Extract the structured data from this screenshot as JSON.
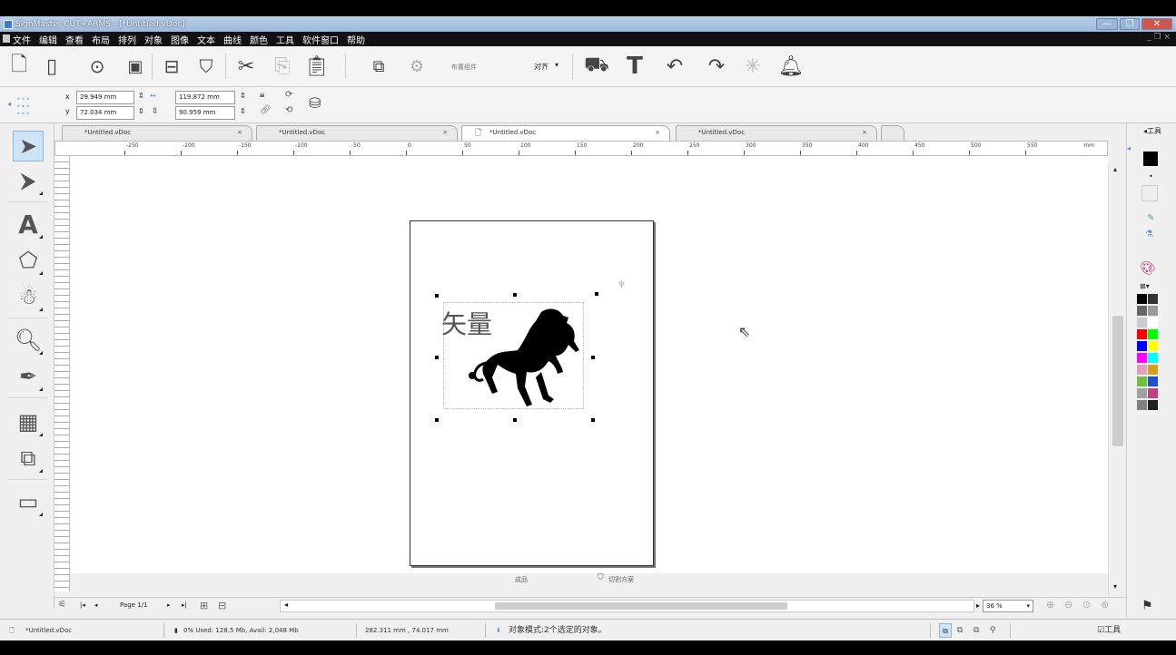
{
  "window": {
    "title": "SignMaster CUT+ARMS - [*Untitled.vDoc]",
    "controls": [
      "minimize",
      "restore",
      "close"
    ]
  },
  "menu": {
    "items": [
      "文件",
      "编辑",
      "查看",
      "布局",
      "排列",
      "对象",
      "图像",
      "文本",
      "曲线",
      "颜色",
      "工具",
      "软件窗口",
      "帮助"
    ],
    "mdi_controls": "_ ❐ ×"
  },
  "toolbar": {
    "group_label": "布置组件",
    "align_label": "对齐"
  },
  "property_bar": {
    "x_label": "x",
    "x_value": "29.949 mm",
    "y_label": "y",
    "y_value": "72.034 mm",
    "w_value": "119.872 mm",
    "h_value": "90.959 mm"
  },
  "tabs": [
    {
      "label": "*Untitled.vDoc",
      "close": "×"
    },
    {
      "label": "*Untitled.vDoc",
      "close": "×"
    },
    {
      "label": "*Untitled.vDoc",
      "close": "×"
    },
    {
      "label": "*Untitled.vDoc",
      "close": "×"
    }
  ],
  "ruler": {
    "ticks": [
      "-250",
      "-200",
      "-150",
      "-100",
      "-50",
      "0",
      "50",
      "100",
      "150",
      "200",
      "250",
      "300",
      "350",
      "400",
      "450",
      "500",
      "550"
    ],
    "unit": "mm"
  },
  "canvas": {
    "text_object": "矢量",
    "page_labels": [
      "成品",
      "切割方案"
    ]
  },
  "right_panel": {
    "title": "◂工具",
    "colors": [
      "#000000",
      "#333333",
      "#666666",
      "#999999",
      "#cccccc",
      "#ffffff",
      "#ff0000",
      "#00ff00",
      "#0000ff",
      "#ffff00",
      "#ff00ff",
      "#00ffff",
      "#e2a0c0",
      "#d4a020",
      "#70c040",
      "#2050d0",
      "#a0a0a0",
      "#c04080",
      "#808080",
      "#202020"
    ]
  },
  "navigation": {
    "first": "|◂",
    "prev": "◂",
    "page_label": "Page 1/1",
    "next": "▸",
    "last": "▸|",
    "zoom": "36 %"
  },
  "status": {
    "doc": "*Untitled.vDoc",
    "memory": "0%   Used: 128.5 Mb, Avail: 2,048 Mb",
    "coords": "282.311 mm , 74.017 mm",
    "mode": "对象模式:2个选定的对象。",
    "right_label": "☑工具"
  }
}
